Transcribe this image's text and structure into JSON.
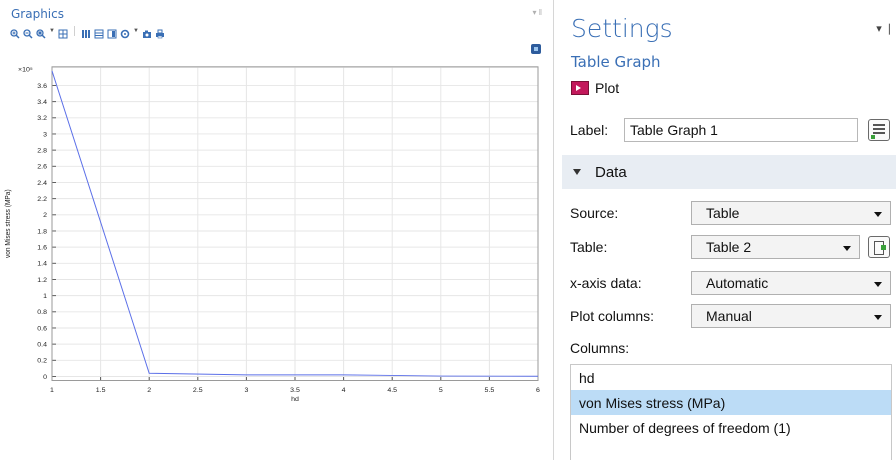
{
  "graphics": {
    "title": "Graphics",
    "toolbar_icons": [
      "zoom-in-icon",
      "zoom-out-icon",
      "zoom-box-icon",
      "zoom-extents-icon",
      "pan-icon",
      "table-columns-icon",
      "table-rows-icon",
      "legend-icon",
      "settings-icon",
      "camera-icon",
      "print-icon"
    ],
    "corner_icon": "image-snapshot-icon"
  },
  "chart_data": {
    "type": "line",
    "xlabel": "hd",
    "ylabel": "von Mises stress (MPa)",
    "y_multiplier": "×10⁵",
    "xlim": [
      1,
      6
    ],
    "ylim": [
      -0.05,
      3.83
    ],
    "grid": true,
    "x_ticks": [
      "1",
      "1.5",
      "2",
      "2.5",
      "3",
      "3.5",
      "4",
      "4.5",
      "5",
      "5.5",
      "6"
    ],
    "y_ticks": [
      "0",
      "0.2",
      "0.4",
      "0.6",
      "0.8",
      "1",
      "1.2",
      "1.4",
      "1.6",
      "1.8",
      "2",
      "2.2",
      "2.4",
      "2.6",
      "2.8",
      "3",
      "3.2",
      "3.4",
      "3.6"
    ],
    "series": [
      {
        "color": "#5b6fe8",
        "x": [
          1,
          2,
          3,
          4,
          5,
          6
        ],
        "y": [
          3.78,
          0.04,
          0.02,
          0.02,
          0.005,
          0.003
        ]
      }
    ]
  },
  "settings": {
    "title": "Settings",
    "subtitle": "Table Graph",
    "plot_label": "Plot",
    "label_field": {
      "label": "Label:",
      "value": "Table Graph 1"
    },
    "section": "Data",
    "source": {
      "label": "Source:",
      "value": "Table"
    },
    "table": {
      "label": "Table:",
      "value": "Table 2"
    },
    "xaxis": {
      "label": "x-axis data:",
      "value": "Automatic"
    },
    "plotcols": {
      "label": "Plot columns:",
      "value": "Manual"
    },
    "columns_label": "Columns:",
    "columns": [
      "hd",
      "von Mises stress (MPa)",
      "Number of degrees of freedom (1)"
    ],
    "selected_column": 1
  }
}
